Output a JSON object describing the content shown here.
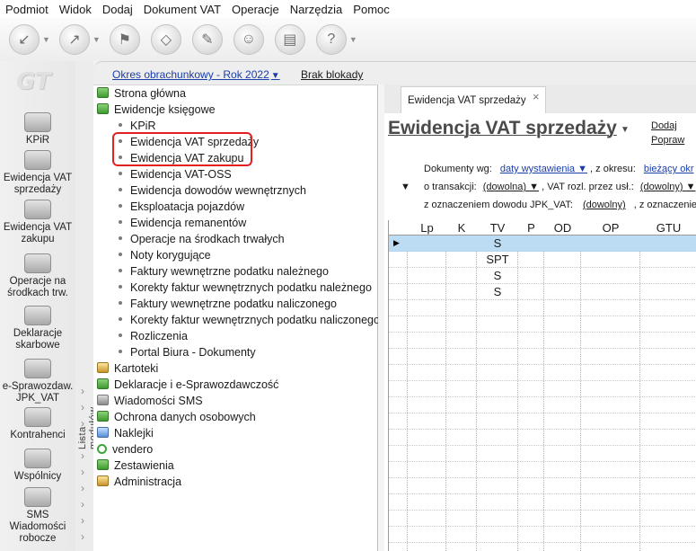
{
  "menu": [
    "Podmiot",
    "Widok",
    "Dodaj",
    "Dokument VAT",
    "Operacje",
    "Narzędzia",
    "Pomoc"
  ],
  "toolbar": {
    "buttons": [
      {
        "icon": "navigate-back-icon",
        "glyph": "↙",
        "has_caret": true
      },
      {
        "icon": "navigate-forward-icon",
        "glyph": "↗",
        "has_caret": true
      },
      {
        "icon": "stamp-icon",
        "glyph": "⚑",
        "has_caret": false
      },
      {
        "icon": "eraser-icon",
        "glyph": "◇",
        "has_caret": false
      },
      {
        "icon": "tools-icon",
        "glyph": "✎",
        "has_caret": false
      },
      {
        "icon": "users-icon",
        "glyph": "☺",
        "has_caret": false
      },
      {
        "icon": "printer-icon",
        "glyph": "▤",
        "has_caret": false
      },
      {
        "icon": "help-icon",
        "glyph": "?",
        "has_caret": true
      }
    ]
  },
  "left_rail": {
    "logo": "GT",
    "items": [
      {
        "label": "KPiR",
        "icon": "kpir-icon"
      },
      {
        "label": "Ewidencja VAT sprzedaży",
        "icon": "vat-sales-icon"
      },
      {
        "label": "Ewidencja VAT zakupu",
        "icon": "vat-purchase-icon"
      },
      {
        "label": "Operacje na środkach trw.",
        "icon": "fixed-assets-icon"
      },
      {
        "label": "Deklaracje skarbowe",
        "icon": "tax-declarations-icon"
      },
      {
        "label": "e-Sprawozdaw. JPK_VAT",
        "icon": "jpk-icon"
      },
      {
        "label": "Kontrahenci",
        "icon": "contractors-icon"
      },
      {
        "label": "Wspólnicy",
        "icon": "partners-icon"
      },
      {
        "label": "SMS Wiadomości robocze",
        "icon": "sms-icon"
      }
    ],
    "modules_label": "Lista modułów"
  },
  "period_bar": {
    "period": "Okres obrachunkowy - Rok 2022",
    "block": "Brak blokady"
  },
  "tree": [
    {
      "label": "Strona główna",
      "level": 0,
      "icon": "home-icon"
    },
    {
      "label": "Ewidencje księgowe",
      "level": 0,
      "icon": "ledger-icon"
    },
    {
      "label": "KPiR",
      "level": 1
    },
    {
      "label": "Ewidencja VAT sprzedaży",
      "level": 1,
      "highlighted": true
    },
    {
      "label": "Ewidencja VAT zakupu",
      "level": 1,
      "highlighted": true
    },
    {
      "label": "Ewidencja VAT-OSS",
      "level": 1
    },
    {
      "label": "Ewidencja dowodów wewnętrznych",
      "level": 1
    },
    {
      "label": "Eksploatacja pojazdów",
      "level": 1
    },
    {
      "label": "Ewidencja remanentów",
      "level": 1
    },
    {
      "label": "Operacje na środkach trwałych",
      "level": 1
    },
    {
      "label": "Noty korygujące",
      "level": 1
    },
    {
      "label": "Faktury wewnętrzne podatku należnego",
      "level": 1
    },
    {
      "label": "Korekty faktur wewnętrznych podatku należnego",
      "level": 1
    },
    {
      "label": "Faktury wewnętrzne podatku naliczonego",
      "level": 1
    },
    {
      "label": "Korekty faktur wewnętrznych podatku naliczonego",
      "level": 1
    },
    {
      "label": "Rozliczenia",
      "level": 1
    },
    {
      "label": "Portal Biura - Dokumenty",
      "level": 1
    },
    {
      "label": "Kartoteki",
      "level": 0,
      "icon": "cards-icon"
    },
    {
      "label": "Deklaracje i e-Sprawozdawczość",
      "level": 0,
      "icon": "declarations-icon"
    },
    {
      "label": "Wiadomości SMS",
      "level": 0,
      "icon": "sms-icon"
    },
    {
      "label": "Ochrona danych osobowych",
      "level": 0,
      "icon": "data-protection-icon"
    },
    {
      "label": "Naklejki",
      "level": 0,
      "icon": "stickers-icon"
    },
    {
      "label": "vendero",
      "level": 0,
      "icon": "vendero-icon"
    },
    {
      "label": "Zestawienia",
      "level": 0,
      "icon": "reports-icon"
    },
    {
      "label": "Administracja",
      "level": 0,
      "icon": "admin-icon"
    }
  ],
  "tab": {
    "label": "Ewidencja VAT sprzedaży",
    "close": "×"
  },
  "document": {
    "title": "Ewidencja VAT sprzedaży",
    "add": "Dodaj",
    "edit": "Popraw"
  },
  "filters": {
    "line1_label": "Dokumenty wg:",
    "line1_value": "daty wystawienia",
    "line1_label2": ", z okresu:",
    "line1_value2": "bieżący okr",
    "line2_label": "o transakcji:",
    "line2_value": "(dowolna)",
    "line2_label2": ", VAT rozl. przez usł.:",
    "line2_value2": "(dowolny)",
    "line3_label": "z oznaczeniem dowodu JPK_VAT:",
    "line3_value": "(dowolny)",
    "line3_label2": ", z oznaczenien"
  },
  "grid": {
    "columns": [
      "",
      "Lp",
      "K",
      "TV",
      "P",
      "OD",
      "OP",
      "GTU"
    ],
    "rows": [
      "S",
      "SPT",
      "S",
      "S"
    ]
  }
}
